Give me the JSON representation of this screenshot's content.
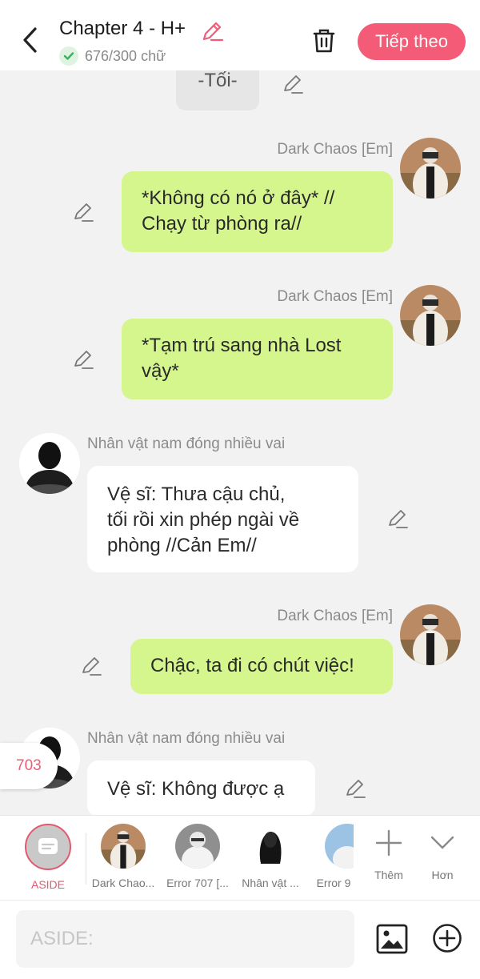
{
  "header": {
    "title": "Chapter 4 - H+",
    "word_count": "676/300 chữ",
    "next_label": "Tiếp theo",
    "accent": "#f45b76"
  },
  "chat": {
    "scene_label": "-Tối-",
    "counter": "703",
    "messages": [
      {
        "side": "right",
        "name": "Dark Chaos [Em]",
        "text_lines": [
          "*Không có nó ở đây* //",
          "Chạy từ phòng ra//"
        ]
      },
      {
        "side": "right",
        "name": "Dark Chaos [Em]",
        "text_lines": [
          "*Tạm trú sang nhà Lost",
          "vậy*"
        ]
      },
      {
        "side": "left",
        "name": "Nhân vật nam đóng nhiều vai",
        "text_lines": [
          "Vệ sĩ: Thưa cậu chủ,",
          "tối rồi xin phép ngài về",
          "phòng //Cản Em//"
        ]
      },
      {
        "side": "right",
        "name": "Dark Chaos [Em]",
        "text_lines": [
          "Chậc, ta đi có chút việc!"
        ]
      },
      {
        "side": "left",
        "name": "Nhân vật nam đóng nhiều vai",
        "text_lines": [
          "Vệ sĩ: Không được ạ"
        ]
      }
    ]
  },
  "characters": {
    "aside_label": "ASIDE",
    "items": [
      "Dark Chao...",
      "Error 707 [...",
      "Nhân vật ...",
      "Error 9"
    ],
    "add_label": "Thêm",
    "more_label": "Hơn"
  },
  "input": {
    "placeholder": "ASIDE:"
  },
  "colors": {
    "bubble_green": "#d5f58d",
    "bubble_white": "#ffffff",
    "background": "#f2f2f2"
  }
}
